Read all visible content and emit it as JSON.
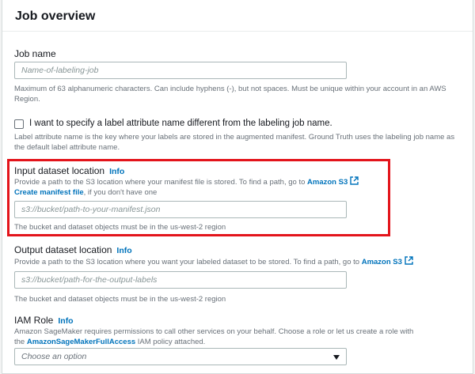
{
  "panel": {
    "title": "Job overview"
  },
  "job_name": {
    "label": "Job name",
    "placeholder": "Name-of-labeling-job",
    "description": "Maximum of 63 alphanumeric characters. Can include hyphens (-), but not spaces. Must be unique within your account in an AWS Region."
  },
  "label_attribute": {
    "checkbox_label": "I want to specify a label attribute name different from the labeling job name.",
    "checked": false,
    "description": "Label attribute name is the key where your labels are stored in the augmented manifest. Ground Truth uses the labeling job name as the default label attribute name."
  },
  "input_dataset": {
    "label": "Input dataset location",
    "info": "Info",
    "description_prefix": "Provide a path to the S3 location where your manifest file is stored. To find a path, go to",
    "s3_link": "Amazon S3",
    "create_manifest_link": "Create manifest file",
    "create_manifest_suffix": ", if you don't have one",
    "placeholder": "s3://bucket/path-to-your-manifest.json",
    "hint": "The bucket and dataset objects must be in the us-west-2 region"
  },
  "output_dataset": {
    "label": "Output dataset location",
    "info": "Info",
    "description_prefix": "Provide a path to the S3 location where you want your labeled dataset to be stored. To find a path, go to",
    "s3_link": "Amazon S3",
    "placeholder": "s3://bucket/path-for-the-output-labels",
    "hint": "The bucket and dataset objects must be in the us-west-2 region"
  },
  "iam_role": {
    "label": "IAM Role",
    "info": "Info",
    "description_line1": "Amazon SageMaker requires permissions to call other services on your behalf. Choose a role or let us create a role with",
    "description_prefix2": "the",
    "policy_link": "AmazonSageMakerFullAccess",
    "description_suffix2": "IAM policy attached.",
    "select_placeholder": "Choose an option"
  },
  "colors": {
    "link": "#0073bb",
    "highlight": "#e3141b",
    "muted_text": "#687078"
  }
}
